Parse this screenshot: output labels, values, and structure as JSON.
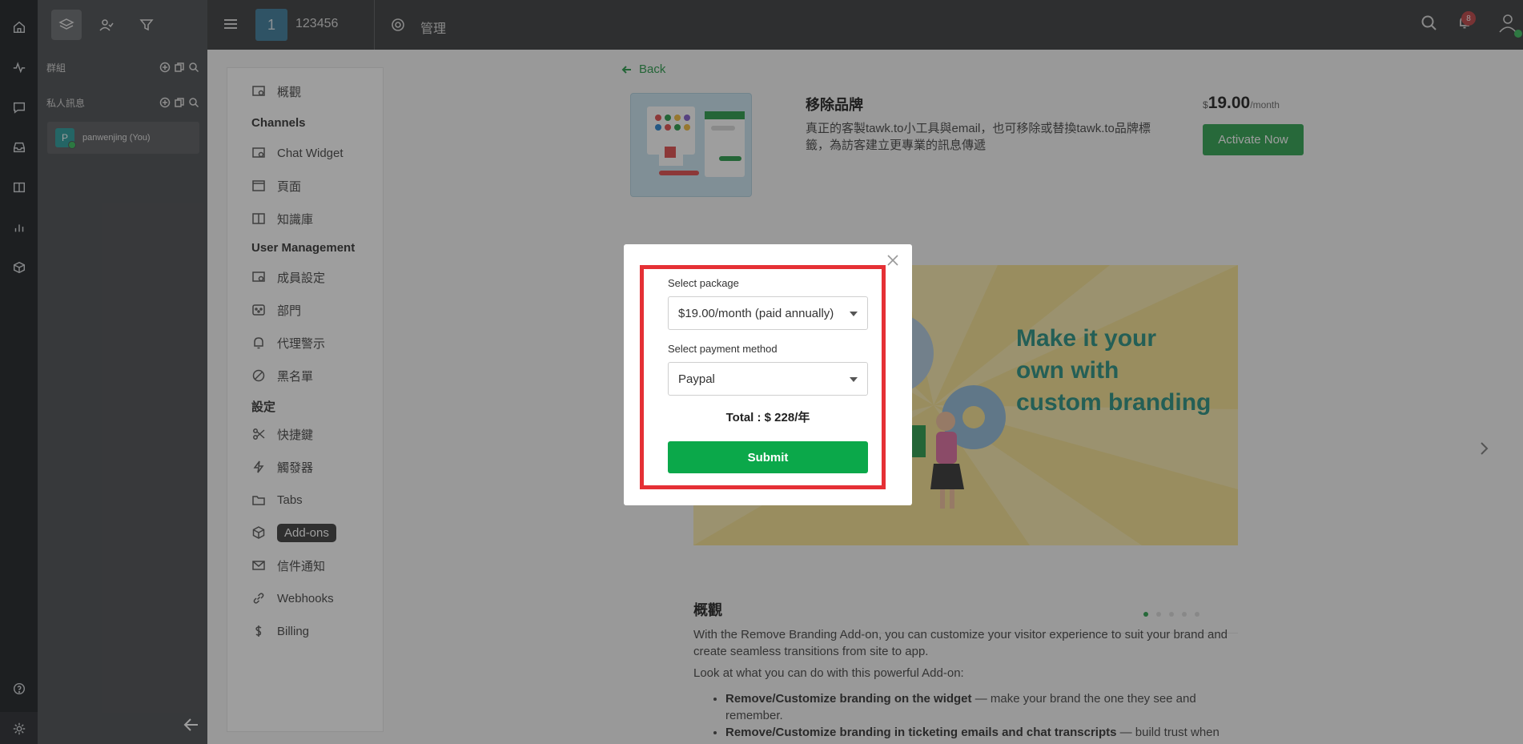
{
  "panel": {
    "groups_label": "群組",
    "private_label": "私人訊息",
    "contact_initial": "P",
    "contact_name": "panwenjing (You)"
  },
  "topbar": {
    "property_number": "1",
    "property_name": "123456",
    "admin_label": "管理",
    "notification_count": "8"
  },
  "menu": {
    "overview": "概觀",
    "channels_head": "Channels",
    "chat_widget": "Chat Widget",
    "pages": "頁面",
    "knowledge_base": "知識庫",
    "user_mgmt_head": "User Management",
    "members": "成員設定",
    "departments": "部門",
    "agent_alerts": "代理警示",
    "blacklist": "黑名單",
    "settings_head": "設定",
    "shortcuts": "快捷鍵",
    "triggers": "觸發器",
    "tabs": "Tabs",
    "addons": "Add-ons",
    "email_notifications": "信件通知",
    "webhooks": "Webhooks",
    "billing": "Billing"
  },
  "addon": {
    "back": "Back",
    "title": "移除品牌",
    "description": "真正的客製tawk.to小工具與email，也可移除或替換tawk.to品牌標籤，為訪客建立更專業的訊息傳遞",
    "price_currency": "$",
    "price_amount": "19.00",
    "price_period": "/month",
    "activate": "Activate Now",
    "banner_line1": "Make it your",
    "banner_line2": "own with",
    "banner_line3": "custom branding",
    "overview_title": "概觀",
    "overview_p1": "With the Remove Branding Add-on, you can customize your visitor experience to suit your brand and create seamless transitions from site to app.",
    "overview_p2": "Look at what you can do with this powerful Add-on:",
    "bullet1_bold": "Remove/Customize branding on the widget",
    "bullet1_rest": " — make your brand the one they see and remember.",
    "bullet2_bold": "Remove/Customize branding in ticketing emails and chat transcripts",
    "bullet2_rest": " — build trust when you show up consistently every time."
  },
  "modal": {
    "package_label": "Select package",
    "package_value": "$19.00/month (paid annually)",
    "payment_label": "Select payment method",
    "payment_value": "Paypal",
    "total": "Total : $ 228/年",
    "submit": "Submit"
  },
  "colors": {
    "accent_green": "#3faa5e",
    "submit_green": "#0ba84a",
    "highlight_red": "#e53035"
  }
}
